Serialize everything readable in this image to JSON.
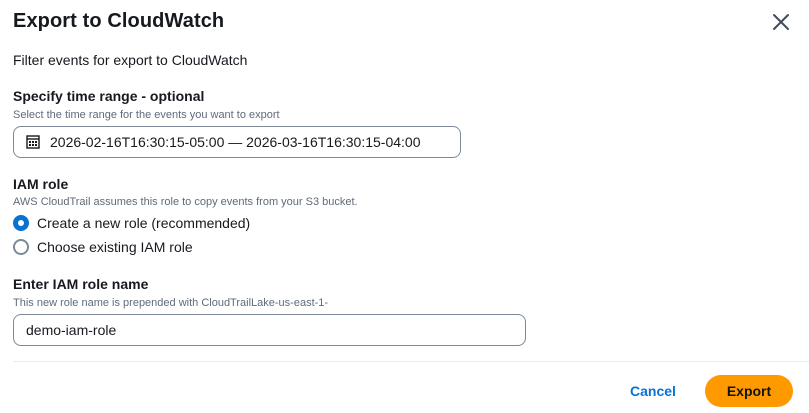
{
  "modal": {
    "title": "Export to CloudWatch",
    "subtitle": "Filter events for export to CloudWatch"
  },
  "time_range": {
    "label": "Specify time range - optional",
    "description": "Select the time range for the events you want to export",
    "value": "2026-02-16T16:30:15-05:00 — 2026-03-16T16:30:15-04:00",
    "icon": "calendar-icon"
  },
  "iam_role": {
    "label": "IAM role",
    "description": "AWS CloudTrail assumes this role to copy events from your S3 bucket.",
    "options": [
      {
        "label": "Create a new role (recommended)",
        "selected": true
      },
      {
        "label": "Choose existing IAM role",
        "selected": false
      }
    ]
  },
  "role_name": {
    "label": "Enter IAM role name",
    "description": "This new role name is prepended with CloudTrailLake-us-east-1-",
    "value": "demo-iam-role"
  },
  "footer": {
    "cancel_label": "Cancel",
    "export_label": "Export"
  },
  "colors": {
    "primary": "#0972d3",
    "export_button": "#ff9900",
    "text": "#16191f",
    "muted_text": "#5f6b7a",
    "border": "#7d8998"
  }
}
